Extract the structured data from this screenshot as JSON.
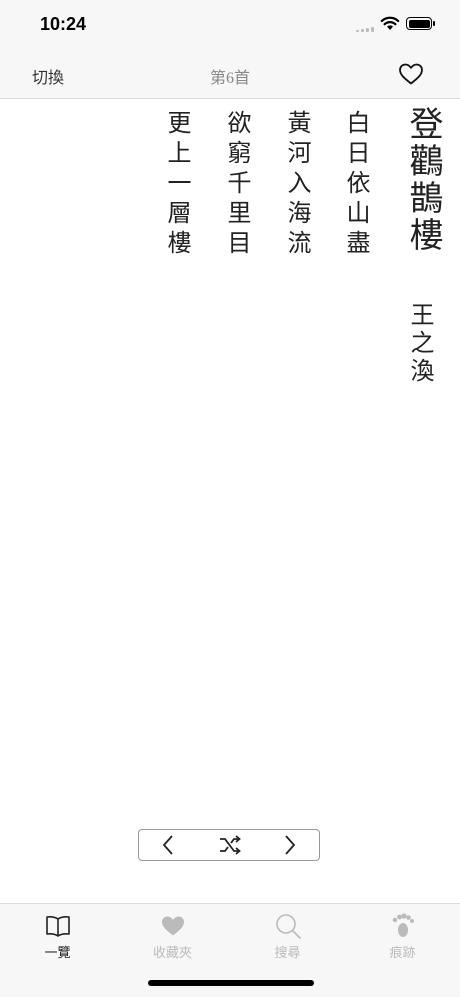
{
  "status": {
    "time": "10:24"
  },
  "nav": {
    "switch_label": "切換",
    "title": "第6首"
  },
  "poem": {
    "title": "登鸛鵲樓",
    "author": "王之渙",
    "lines": [
      "白日依山盡",
      "黃河入海流",
      "欲窮千里目",
      "更上一層樓"
    ]
  },
  "controls": {
    "prev_icon": "chevron-left-icon",
    "shuffle_icon": "shuffle-icon",
    "next_icon": "chevron-right-icon"
  },
  "tabs": [
    {
      "label": "一覽",
      "icon": "book-icon",
      "active": true
    },
    {
      "label": "收藏夾",
      "icon": "heart-icon",
      "active": false
    },
    {
      "label": "搜尋",
      "icon": "search-icon",
      "active": false
    },
    {
      "label": "痕跡",
      "icon": "footprints-icon",
      "active": false
    }
  ],
  "colors": {
    "active_tab": "#222222",
    "inactive_tab": "#bbbbbb",
    "bar_bg": "#f7f7f7"
  }
}
